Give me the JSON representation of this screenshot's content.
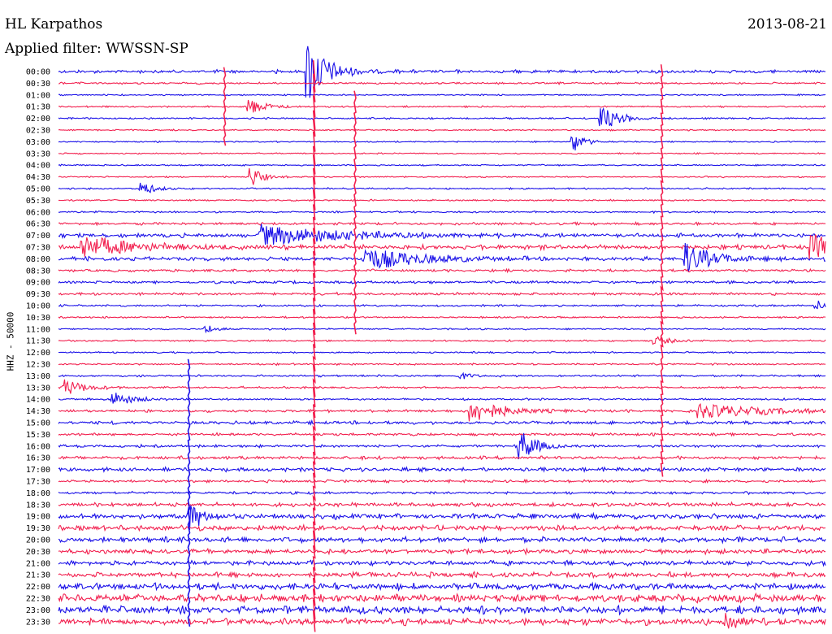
{
  "header": {
    "station": "HL Karpathos",
    "date": "2013-08-21",
    "filter": "Applied filter: WWSSN-SP",
    "channel": "HHZ - 50000"
  },
  "colors": {
    "even_rows": "#1a10e8",
    "odd_rows": "#f2204f",
    "background": "#ffffff",
    "text": "#000000"
  },
  "chart_data": {
    "type": "line",
    "title": "HL Karpathos",
    "subtitle": "Applied filter: WWSSN-SP",
    "ylabel": "HHZ - 50000",
    "xlabel": "",
    "date": "2013-08-21",
    "row_minutes": 30,
    "row_labels": [
      "00:00",
      "00:30",
      "01:00",
      "01:30",
      "02:00",
      "02:30",
      "03:00",
      "03:30",
      "04:00",
      "04:30",
      "05:00",
      "05:30",
      "06:00",
      "06:30",
      "07:00",
      "07:30",
      "08:00",
      "08:30",
      "09:00",
      "09:30",
      "10:00",
      "10:30",
      "11:00",
      "11:30",
      "12:00",
      "12:30",
      "13:00",
      "13:30",
      "14:00",
      "14:30",
      "15:00",
      "15:30",
      "16:00",
      "16:30",
      "17:00",
      "17:30",
      "18:00",
      "18:30",
      "19:00",
      "19:30",
      "20:00",
      "20:30",
      "21:00",
      "21:30",
      "22:00",
      "22:30",
      "23:00",
      "23:30"
    ],
    "noise_level": [
      2.5,
      1.5,
      1,
      1.2,
      1.3,
      1.1,
      1,
      1,
      1.1,
      1.1,
      1.2,
      1.2,
      1.3,
      2,
      3,
      3.5,
      3,
      2,
      2,
      2,
      1.5,
      1.3,
      1.2,
      1.3,
      1.2,
      1.3,
      1.5,
      1.5,
      1.5,
      2,
      2.5,
      2,
      2,
      2.5,
      3,
      2,
      2,
      3,
      4,
      4,
      4,
      3.5,
      3.5,
      4,
      5,
      6,
      6,
      5
    ],
    "events": [
      {
        "row": 0,
        "minute": 9.8,
        "amplitude": 40,
        "duration_min": 1.5,
        "note": "saturated"
      },
      {
        "row": 3,
        "minute": 7.5,
        "amplitude": 10,
        "duration_min": 1.2
      },
      {
        "row": 4,
        "minute": 21.3,
        "amplitude": 14,
        "duration_min": 1.5
      },
      {
        "row": 6,
        "minute": 20.2,
        "amplitude": 12,
        "duration_min": 0.8
      },
      {
        "row": 9,
        "minute": 7.6,
        "amplitude": 12,
        "duration_min": 0.8
      },
      {
        "row": 10,
        "minute": 3.3,
        "amplitude": 8,
        "duration_min": 1.0
      },
      {
        "row": 14,
        "minute": 8,
        "amplitude": 12,
        "duration_min": 6
      },
      {
        "row": 15,
        "minute": 1,
        "amplitude": 14,
        "duration_min": 3.5
      },
      {
        "row": 15,
        "minute": 29.5,
        "amplitude": 14,
        "duration_min": 3
      },
      {
        "row": 16,
        "minute": 12,
        "amplitude": 14,
        "duration_min": 4
      },
      {
        "row": 16,
        "minute": 24.6,
        "amplitude": 18,
        "duration_min": 2
      },
      {
        "row": 20,
        "minute": 29.7,
        "amplitude": 6,
        "duration_min": 0.5
      },
      {
        "row": 22,
        "minute": 5.8,
        "amplitude": 5,
        "duration_min": 0.8
      },
      {
        "row": 23,
        "minute": 23.4,
        "amplitude": 5,
        "duration_min": 1.2
      },
      {
        "row": 26,
        "minute": 15.8,
        "amplitude": 4,
        "duration_min": 0.8
      },
      {
        "row": 27,
        "minute": 0.3,
        "amplitude": 10,
        "duration_min": 1.5
      },
      {
        "row": 28,
        "minute": 2.2,
        "amplitude": 9,
        "duration_min": 1.4
      },
      {
        "row": 29,
        "minute": 16.2,
        "amplitude": 14,
        "duration_min": 2.5
      },
      {
        "row": 29,
        "minute": 25.1,
        "amplitude": 9,
        "duration_min": 5
      },
      {
        "row": 32,
        "minute": 18.1,
        "amplitude": 20,
        "duration_min": 1.2
      },
      {
        "row": 38,
        "minute": 5.2,
        "amplitude": 16,
        "duration_min": 1.0
      },
      {
        "row": 47,
        "minute": 26.2,
        "amplitude": 12,
        "duration_min": 0.8
      }
    ],
    "spikes": [
      {
        "row_start": 0,
        "row_end": 48,
        "minute": 10.0,
        "amplitude": 14
      },
      {
        "row_start": 0,
        "row_end": 7,
        "minute": 6.5,
        "amplitude": 7
      },
      {
        "row_start": 2,
        "row_end": 23,
        "minute": 11.6,
        "amplitude": 7
      },
      {
        "row_start": 0,
        "row_end": 35,
        "minute": 23.6,
        "amplitude": 9
      },
      {
        "row_start": 25,
        "row_end": 48,
        "minute": 5.1,
        "amplitude": 7
      }
    ],
    "grid": false,
    "legend": "none"
  }
}
